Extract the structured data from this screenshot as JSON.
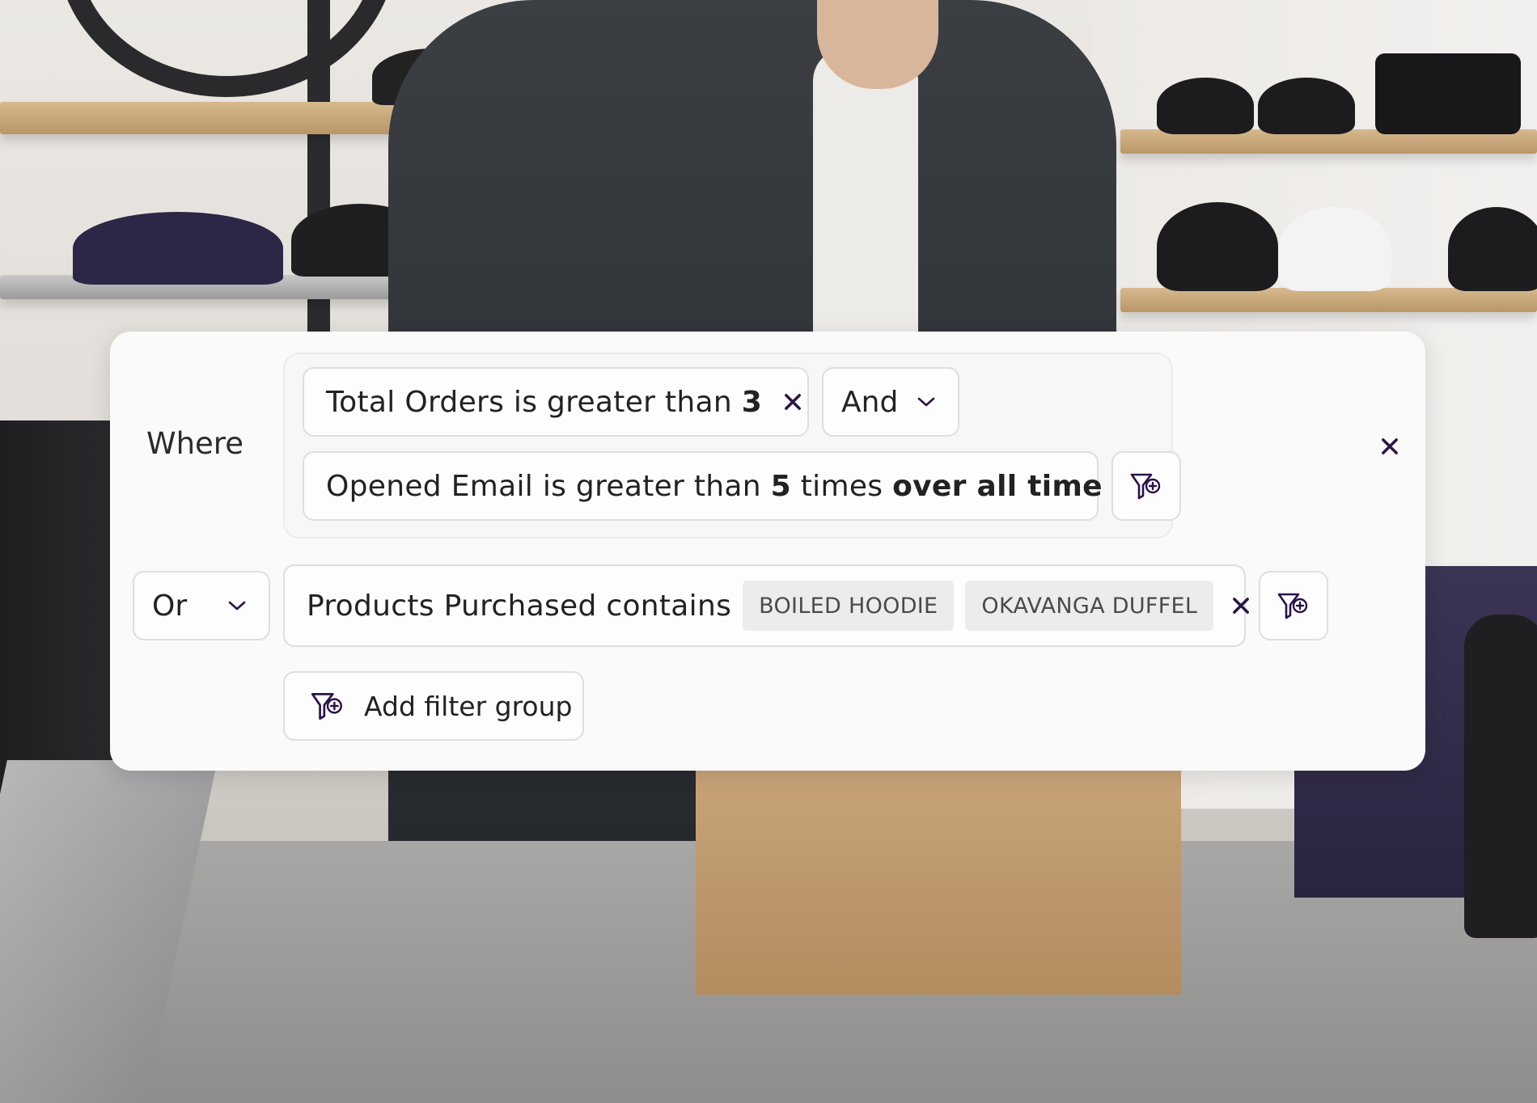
{
  "filter": {
    "where_label": "Where",
    "group": {
      "condition_1": {
        "text": "Total Orders is greater than ",
        "value": "3"
      },
      "operator": "And",
      "condition_2": {
        "prefix": "Opened Email is greater than ",
        "value": "5",
        "middle": " times ",
        "period": "over all time"
      }
    },
    "or_operator": "Or",
    "condition_3": {
      "text": "Products Purchased contains",
      "tags": [
        "BOILED HOODIE",
        "OKAVANGA DUFFEL"
      ]
    },
    "add_group_label": "Add filter group"
  },
  "icons": {
    "close": "close-icon",
    "chevron": "chevron-down-icon",
    "add_filter": "filter-plus-icon"
  },
  "colors": {
    "accent": "#2a1446",
    "card_bg": "#fafafa",
    "border": "#dedede",
    "tag_bg": "#ececec"
  }
}
